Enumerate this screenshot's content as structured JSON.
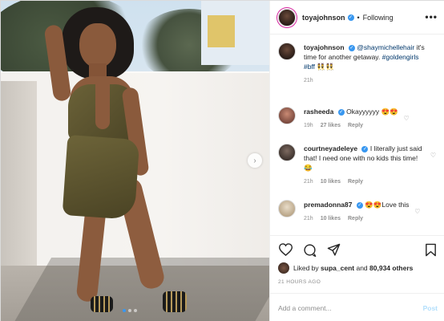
{
  "header": {
    "username": "toyajohnson",
    "follow_status": "Following",
    "separator": "•",
    "more": "•••"
  },
  "caption": {
    "username": "toyajohnson",
    "mention": "@shaymichellehair",
    "text": " it's time for another getaway.",
    "hashtags": "#goldengirls #bff",
    "emoji": "👯👯",
    "time": "21h"
  },
  "comments": [
    {
      "username": "rasheeda",
      "text": "Okayyyyyy 😍😍",
      "time": "19h",
      "likes": "27 likes",
      "reply": "Reply"
    },
    {
      "username": "courtneyadeleye",
      "text": "I literally just said that! I need one with no kids this time! 😂",
      "time": "21h",
      "likes": "10 likes",
      "reply": "Reply"
    },
    {
      "username": "premadonna87",
      "text": "😍😍Love this",
      "time": "21h",
      "likes": "10 likes",
      "reply": "Reply"
    }
  ],
  "actions": {
    "like_icon": "heart-icon",
    "comment_icon": "comment-icon",
    "share_icon": "share-icon",
    "save_icon": "bookmark-icon"
  },
  "likes": {
    "prefix": "Liked by",
    "liker": "supa_cent",
    "and": "and",
    "others": "80,934 others"
  },
  "timestamp": "21 HOURS AGO",
  "add_comment": {
    "placeholder": "Add a comment...",
    "post_label": "Post"
  },
  "carousel": {
    "total": 3,
    "active": 1
  },
  "colors": {
    "verified": "#3897f0",
    "link": "#00376b",
    "muted": "#8e8e8e",
    "post_disabled": "#b2dffc"
  }
}
